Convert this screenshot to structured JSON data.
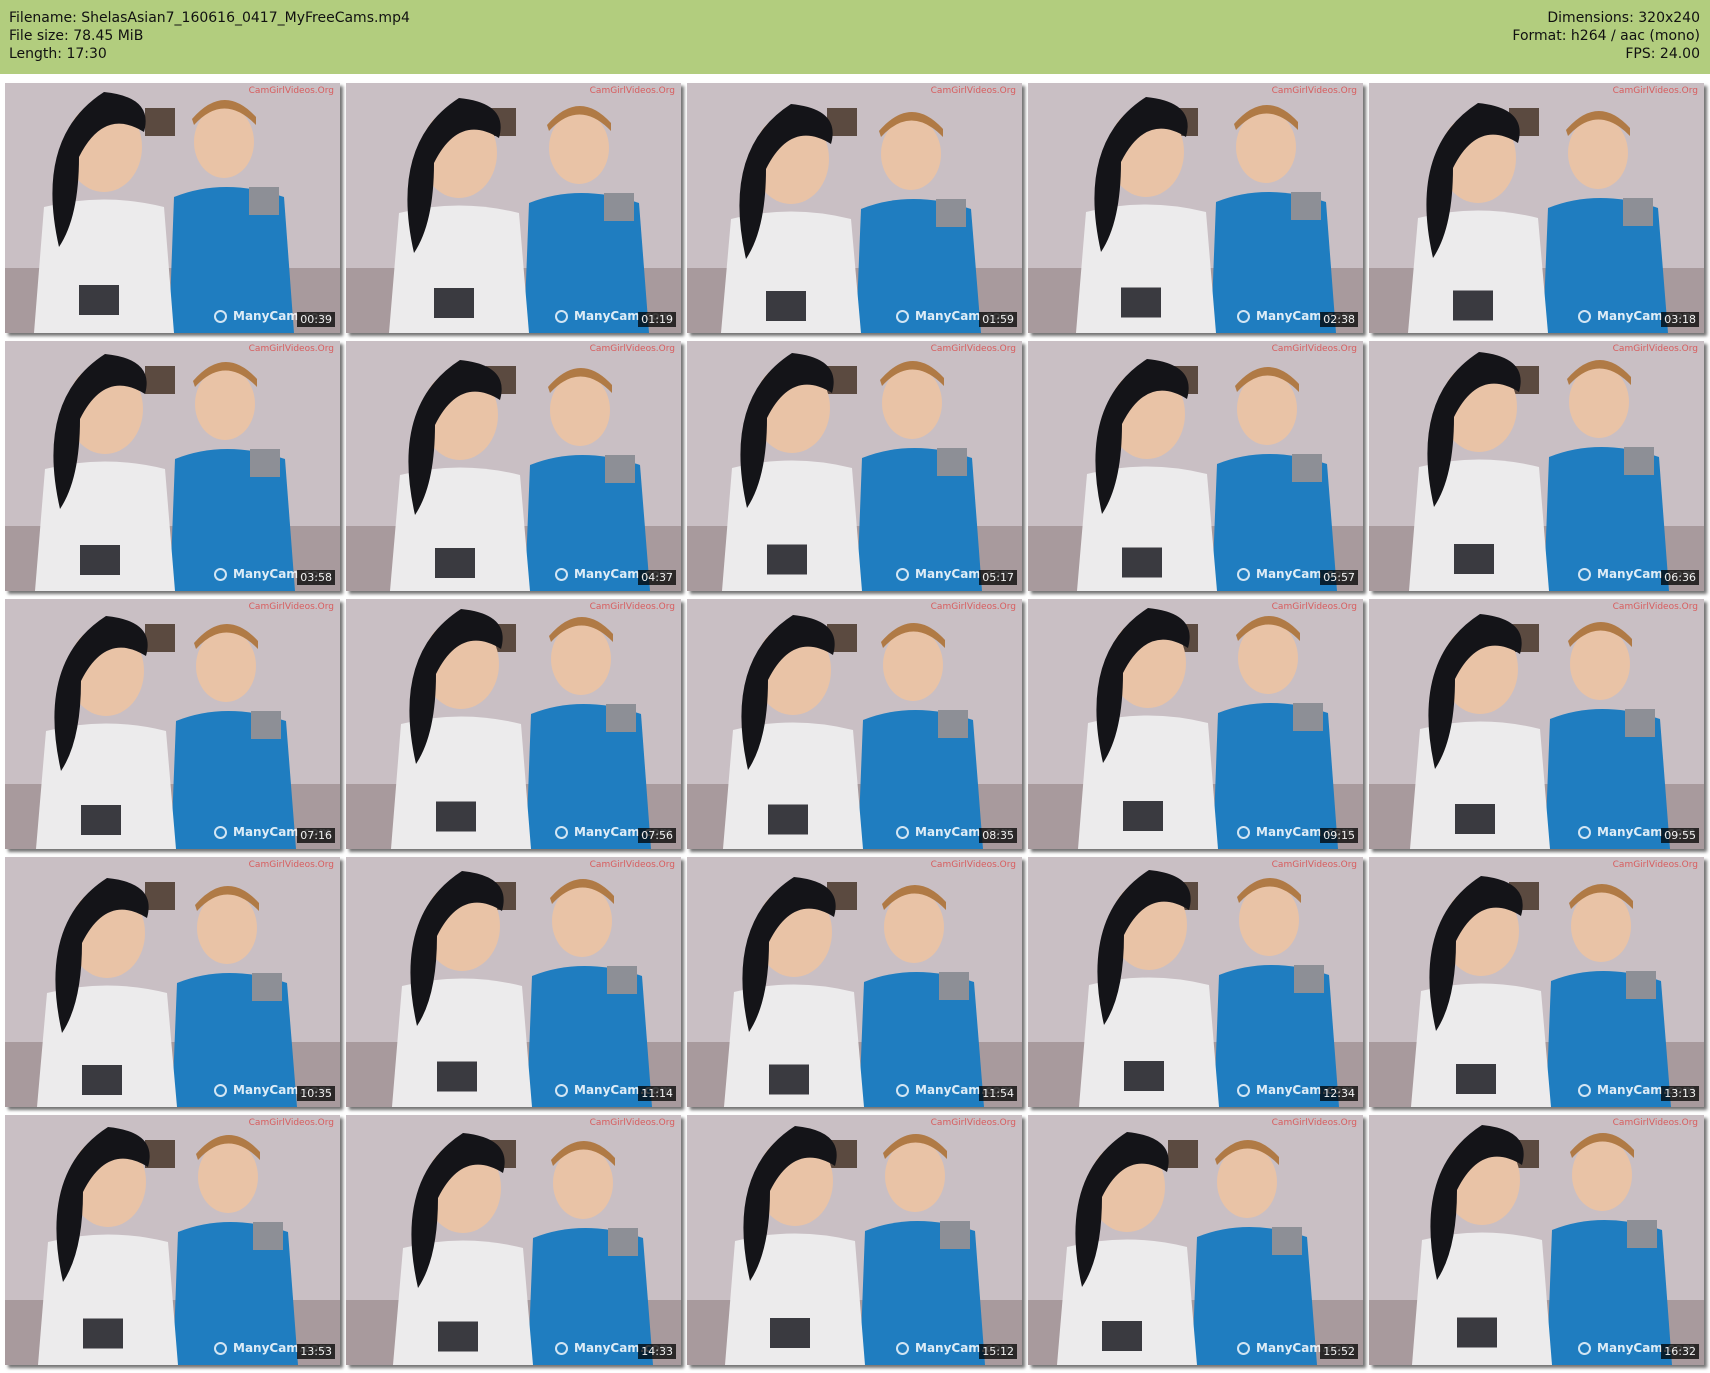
{
  "header": {
    "filename": "Filename: ShelasAsian7_160616_0417_MyFreeCams.mp4",
    "filesize": "File size: 78.45 MiB",
    "length": "Length: 17:30",
    "dimensions": "Dimensions: 320x240",
    "format": "Format: h264 / aac (mono)",
    "fps": "FPS: 24.00"
  },
  "watermarks": {
    "top": "CamGirlVideos.Org",
    "bottom": "ManyCam.com"
  },
  "colors": {
    "header_bg": "#b2cd7e",
    "white_top": "#ecebec",
    "blue_dress": "#1f7dc0",
    "hair": "#141418",
    "skin": "#e9c3a6",
    "wall": "#c9bfc4"
  },
  "thumbnails": [
    {
      "timestamp": "00:39"
    },
    {
      "timestamp": "01:19"
    },
    {
      "timestamp": "01:59"
    },
    {
      "timestamp": "02:38"
    },
    {
      "timestamp": "03:18"
    },
    {
      "timestamp": "03:58"
    },
    {
      "timestamp": "04:37"
    },
    {
      "timestamp": "05:17"
    },
    {
      "timestamp": "05:57"
    },
    {
      "timestamp": "06:36"
    },
    {
      "timestamp": "07:16"
    },
    {
      "timestamp": "07:56"
    },
    {
      "timestamp": "08:35"
    },
    {
      "timestamp": "09:15"
    },
    {
      "timestamp": "09:55"
    },
    {
      "timestamp": "10:35"
    },
    {
      "timestamp": "11:14"
    },
    {
      "timestamp": "11:54"
    },
    {
      "timestamp": "12:34"
    },
    {
      "timestamp": "13:13"
    },
    {
      "timestamp": "13:53"
    },
    {
      "timestamp": "14:33"
    },
    {
      "timestamp": "15:12"
    },
    {
      "timestamp": "15:52"
    },
    {
      "timestamp": "16:32"
    }
  ]
}
